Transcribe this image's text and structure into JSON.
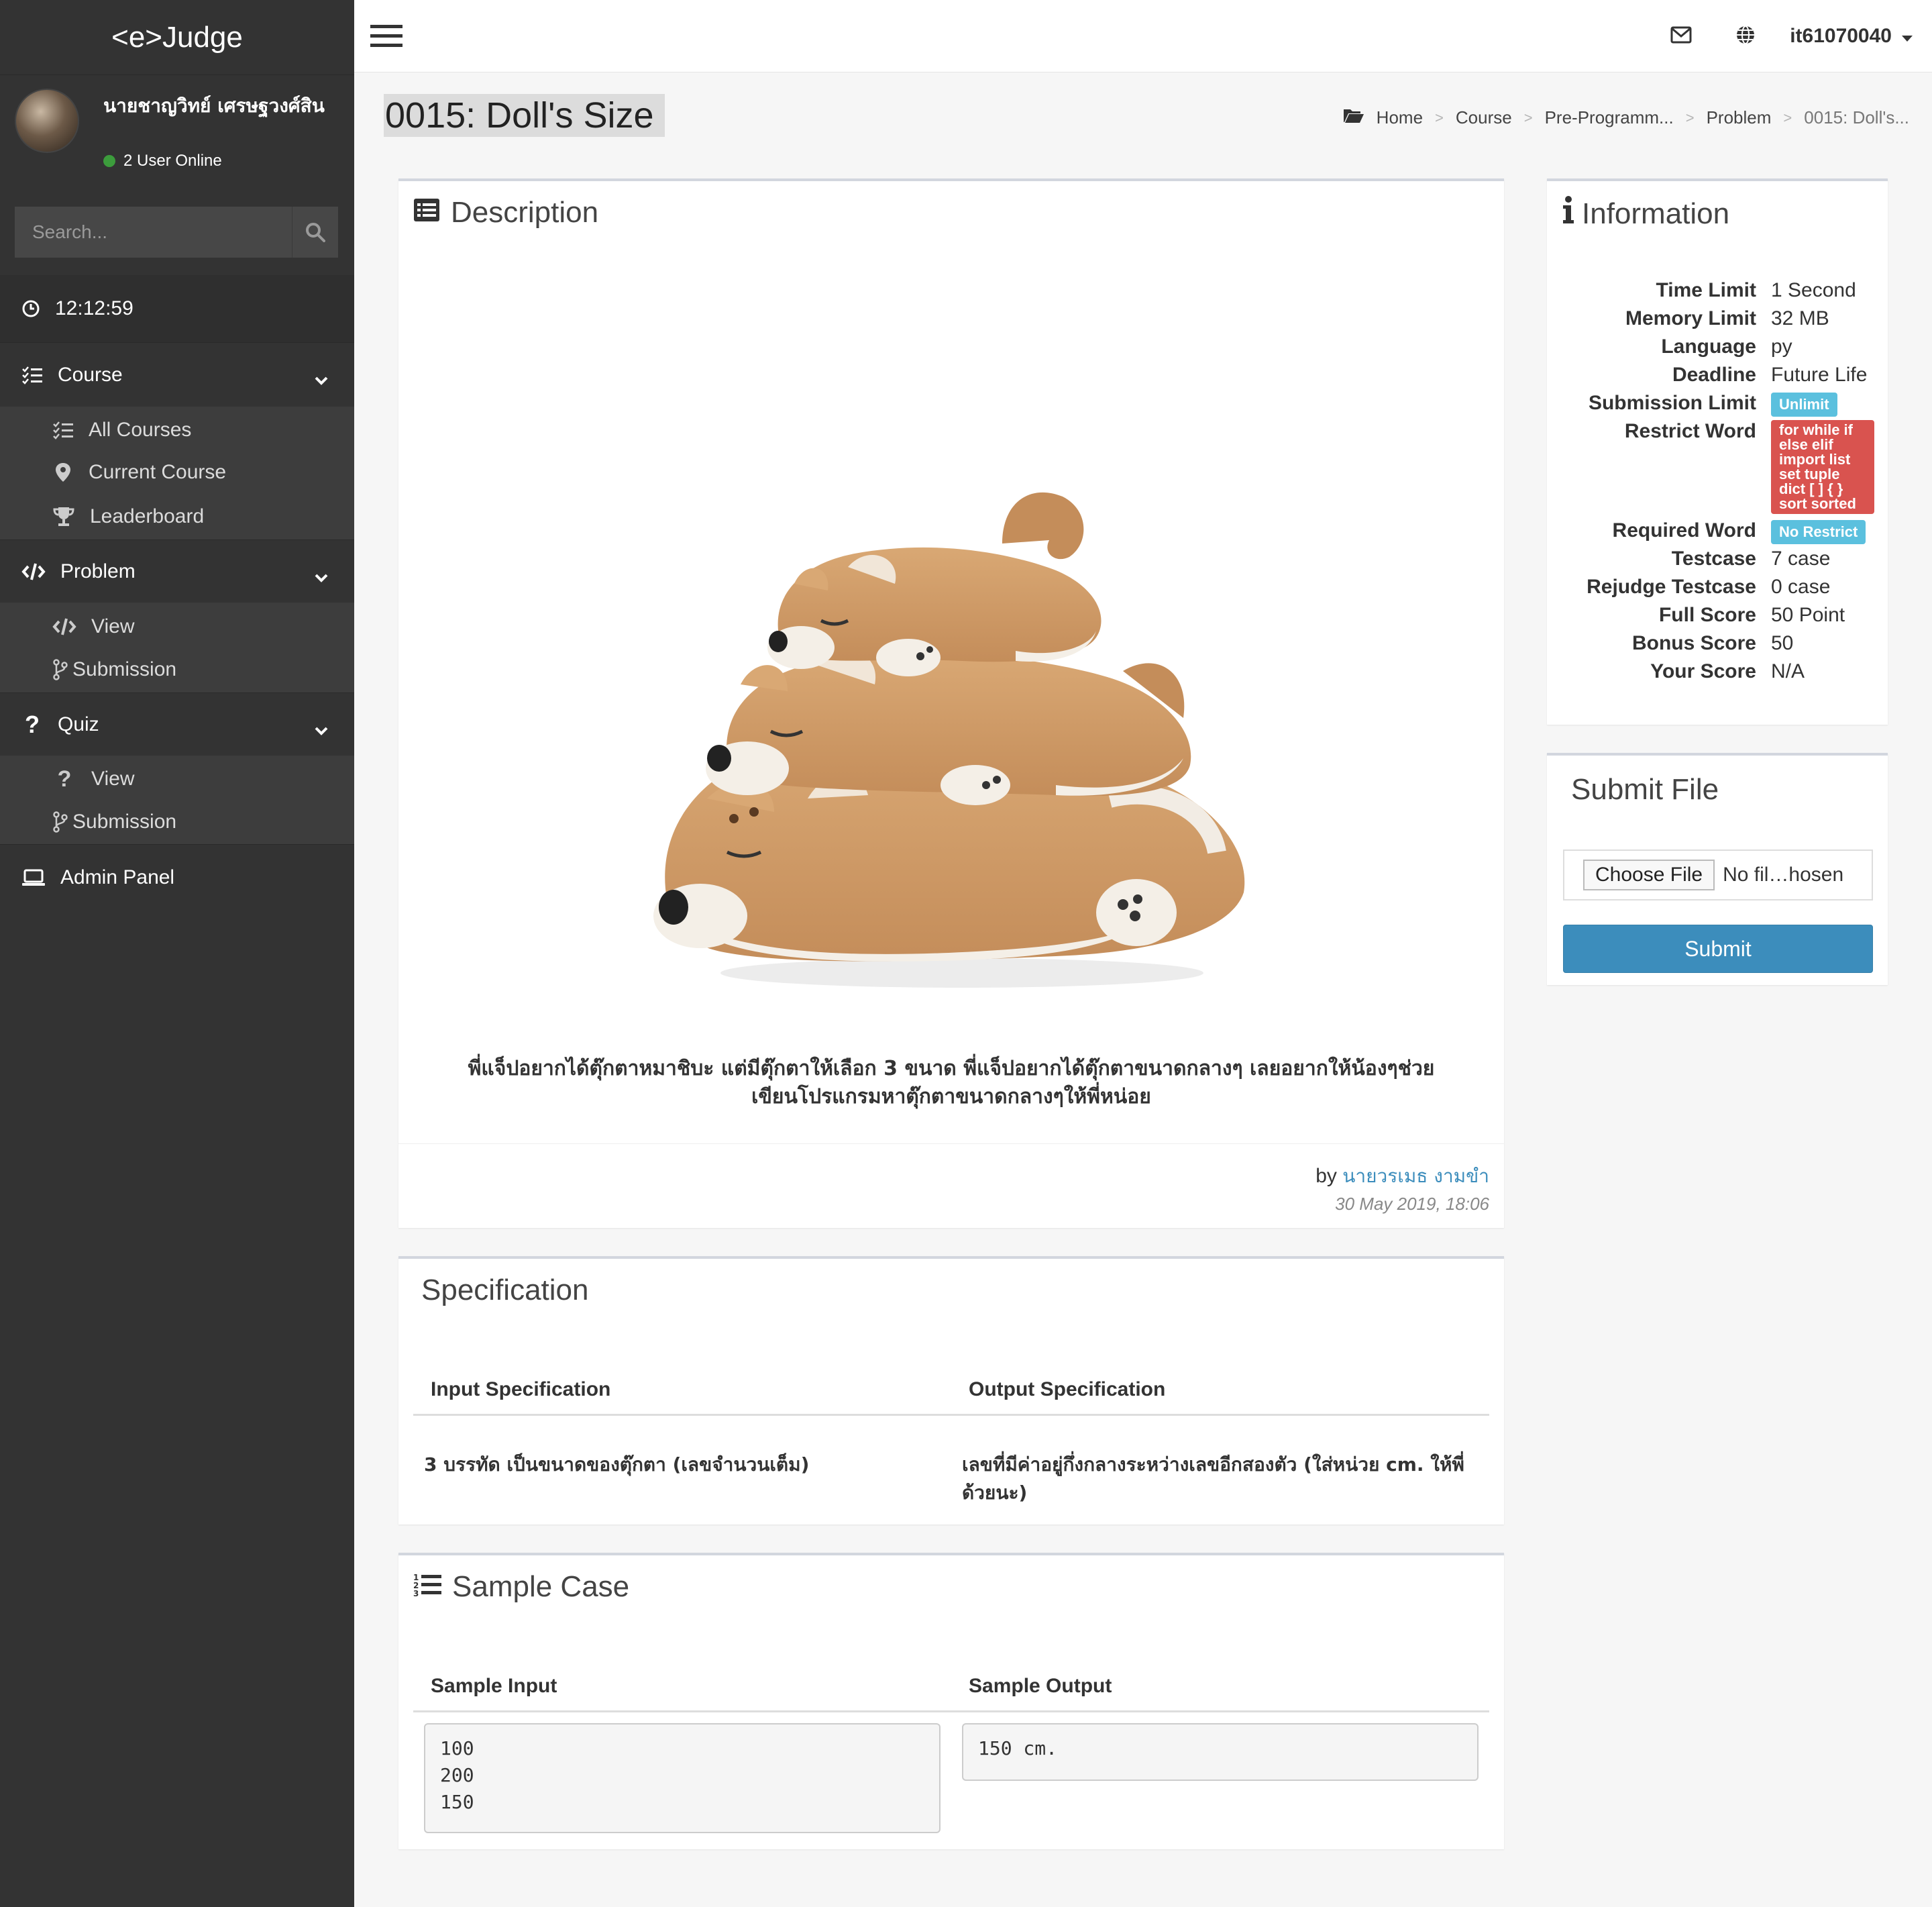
{
  "app": {
    "brand": "<e>Judge"
  },
  "user": {
    "name": "นายชาญวิทย์ เศรษฐวงศ์สิน",
    "online_text": "2 User Online",
    "username": "it61070040"
  },
  "search": {
    "placeholder": "Search..."
  },
  "clock": {
    "time": "12:12:59"
  },
  "sidebar": {
    "course": {
      "label": "Course",
      "items": [
        "All Courses",
        "Current Course",
        "Leaderboard"
      ]
    },
    "problem": {
      "label": "Problem",
      "items": [
        "View",
        "Submission"
      ]
    },
    "quiz": {
      "label": "Quiz",
      "items": [
        "View",
        "Submission"
      ]
    },
    "admin": {
      "label": "Admin Panel"
    }
  },
  "page": {
    "title": "0015: Doll's Size"
  },
  "breadcrumb": [
    "Home",
    "Course",
    "Pre-Programm...",
    "Problem",
    "0015: Doll's..."
  ],
  "description": {
    "heading": "Description",
    "text_line1": "พี่แจ็ปอยากได้ตุ๊กตาหมาชิบะ แต่มีตุ๊กตาให้เลือก 3 ขนาด พี่แจ็ปอยากได้ตุ๊กตาขนาดกลางๆ เลยอยากให้น้องๆช่วย",
    "text_line2": "เขียนโปรแกรมหาตุ๊กตาขนาดกลางๆให้พี่หน่อย",
    "by_label": "by",
    "author": "นายวรเมธ งามขำ",
    "date": "30 May 2019, 18:06"
  },
  "specification": {
    "heading": "Specification",
    "input_header": "Input Specification",
    "output_header": "Output Specification",
    "input_text": "3 บรรทัด เป็นขนาดของตุ๊กตา (เลขจำนวนเต็ม)",
    "output_text": "เลขที่มีค่าอยู่กึ่งกลางระหว่างเลขอีกสองตัว (ใส่หน่วย cm. ให้พี่ด้วยนะ)"
  },
  "sample": {
    "heading": "Sample Case",
    "input_header": "Sample Input",
    "output_header": "Sample Output",
    "input": "100\n200\n150",
    "output": "150 cm."
  },
  "information": {
    "heading": "Information",
    "rows": {
      "time_limit": {
        "k": "Time Limit",
        "v": "1 Second"
      },
      "memory_limit": {
        "k": "Memory Limit",
        "v": "32 MB"
      },
      "language": {
        "k": "Language",
        "v": "py"
      },
      "deadline": {
        "k": "Deadline",
        "v": "Future Life"
      },
      "submission_limit": {
        "k": "Submission Limit",
        "v": "Unlimit"
      },
      "restrict_word": {
        "k": "Restrict Word",
        "v": "for while if else elif import list set tuple dict [ ] { } sort sorted"
      },
      "required_word": {
        "k": "Required Word",
        "v": "No Restrict"
      },
      "testcase": {
        "k": "Testcase",
        "v": "7 case"
      },
      "rejudge_testcase": {
        "k": "Rejudge Testcase",
        "v": "0 case"
      },
      "full_score": {
        "k": "Full Score",
        "v": "50 Point"
      },
      "bonus_score": {
        "k": "Bonus Score",
        "v": "50"
      },
      "your_score": {
        "k": "Your Score",
        "v": "N/A"
      }
    }
  },
  "submit_file": {
    "heading": "Submit File",
    "choose_label": "Choose File",
    "no_file": "No fil…hosen",
    "submit_label": "Submit"
  },
  "colors": {
    "sidebar": "#333333",
    "accent": "#3c8dbc",
    "badge_info": "#5bc0de",
    "badge_danger": "#d9534f",
    "online": "#3c9c3c"
  }
}
